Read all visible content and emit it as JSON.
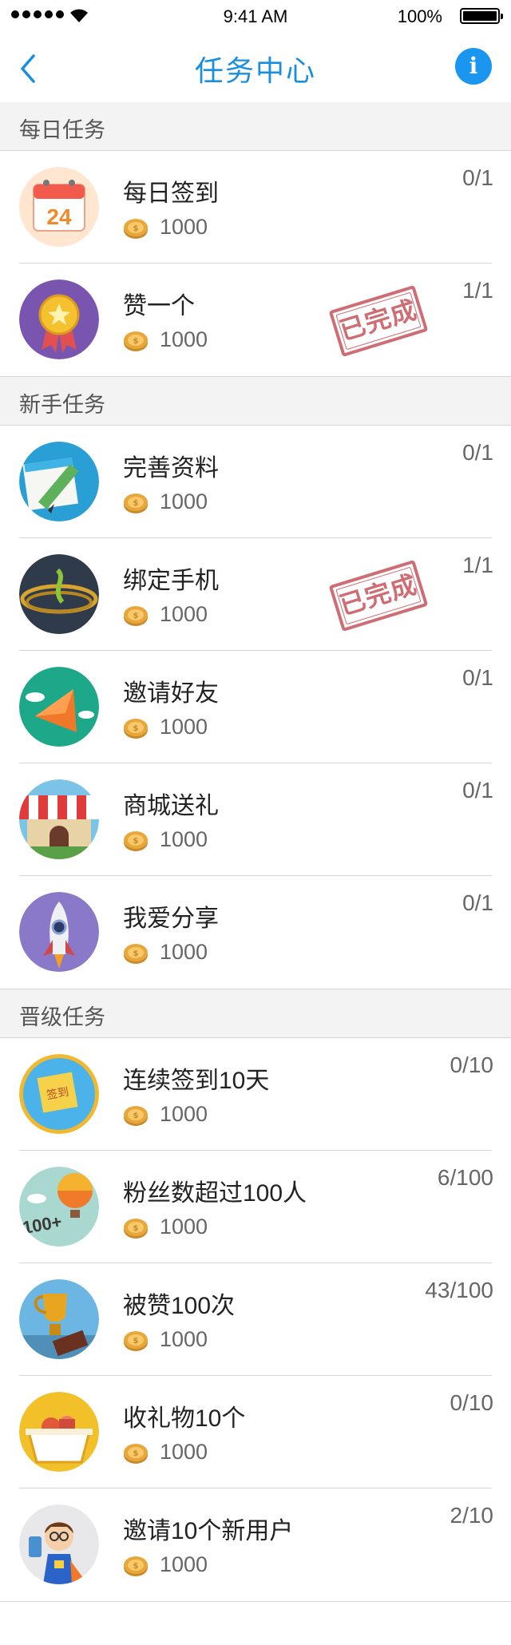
{
  "status_bar": {
    "time": "9:41 AM",
    "battery": "100%"
  },
  "nav": {
    "title": "任务中心",
    "info_label": "i"
  },
  "sections": [
    {
      "title": "每日任务",
      "rows": [
        {
          "name": "每日签到",
          "reward": "1000",
          "progress": "0/1",
          "icon": "calendar-icon",
          "done": false
        },
        {
          "name": "赞一个",
          "reward": "1000",
          "progress": "1/1",
          "icon": "medal-icon",
          "done": true
        }
      ]
    },
    {
      "title": "新手任务",
      "rows": [
        {
          "name": "完善资料",
          "reward": "1000",
          "progress": "0/1",
          "icon": "pencil-note-icon",
          "done": false
        },
        {
          "name": "绑定手机",
          "reward": "1000",
          "progress": "1/1",
          "icon": "phone-cable-icon",
          "done": true
        },
        {
          "name": "邀请好友",
          "reward": "1000",
          "progress": "0/1",
          "icon": "megaphone-icon",
          "done": false
        },
        {
          "name": "商城送礼",
          "reward": "1000",
          "progress": "0/1",
          "icon": "shop-awning-icon",
          "done": false
        },
        {
          "name": "我爱分享",
          "reward": "1000",
          "progress": "0/1",
          "icon": "rocket-icon",
          "done": false
        }
      ]
    },
    {
      "title": "晋级任务",
      "rows": [
        {
          "name": "连续签到10天",
          "reward": "1000",
          "progress": "0/10",
          "icon": "sticky-note-icon",
          "done": false
        },
        {
          "name": "粉丝数超过100人",
          "reward": "1000",
          "progress": "6/100",
          "icon": "balloon-icon",
          "done": false
        },
        {
          "name": "被赞100次",
          "reward": "1000",
          "progress": "43/100",
          "icon": "trophy-icon",
          "done": false
        },
        {
          "name": "收礼物10个",
          "reward": "1000",
          "progress": "0/10",
          "icon": "gift-basket-icon",
          "done": false
        },
        {
          "name": "邀请10个新用户",
          "reward": "1000",
          "progress": "2/10",
          "icon": "superhero-icon",
          "done": false
        }
      ]
    }
  ],
  "stamp_text": "已完成",
  "colors": {
    "accent": "#1a8fe0",
    "stamp": "#c2454f",
    "coin": "#e8a73a"
  }
}
